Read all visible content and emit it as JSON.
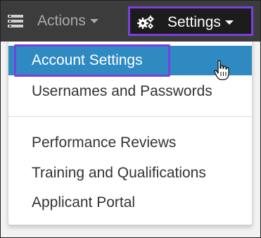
{
  "navbar": {
    "actions_label": "Actions",
    "settings_label": "Settings"
  },
  "menu": {
    "items": [
      {
        "label": "Account Settings",
        "highlighted": true
      },
      {
        "label": "Usernames and Passwords"
      },
      {
        "label": "Performance Reviews"
      },
      {
        "label": "Training and Qualifications"
      },
      {
        "label": "Applicant Portal"
      }
    ]
  },
  "icons": {
    "left": "list-icon",
    "settings": "gears-icon",
    "cursor": "hand-pointer-icon"
  },
  "colors": {
    "navbar_bg": "#3c3c3c",
    "settings_bg": "#1c1c1c",
    "highlight": "#2f8ac2",
    "focus_outline": "#7a3fe0"
  }
}
